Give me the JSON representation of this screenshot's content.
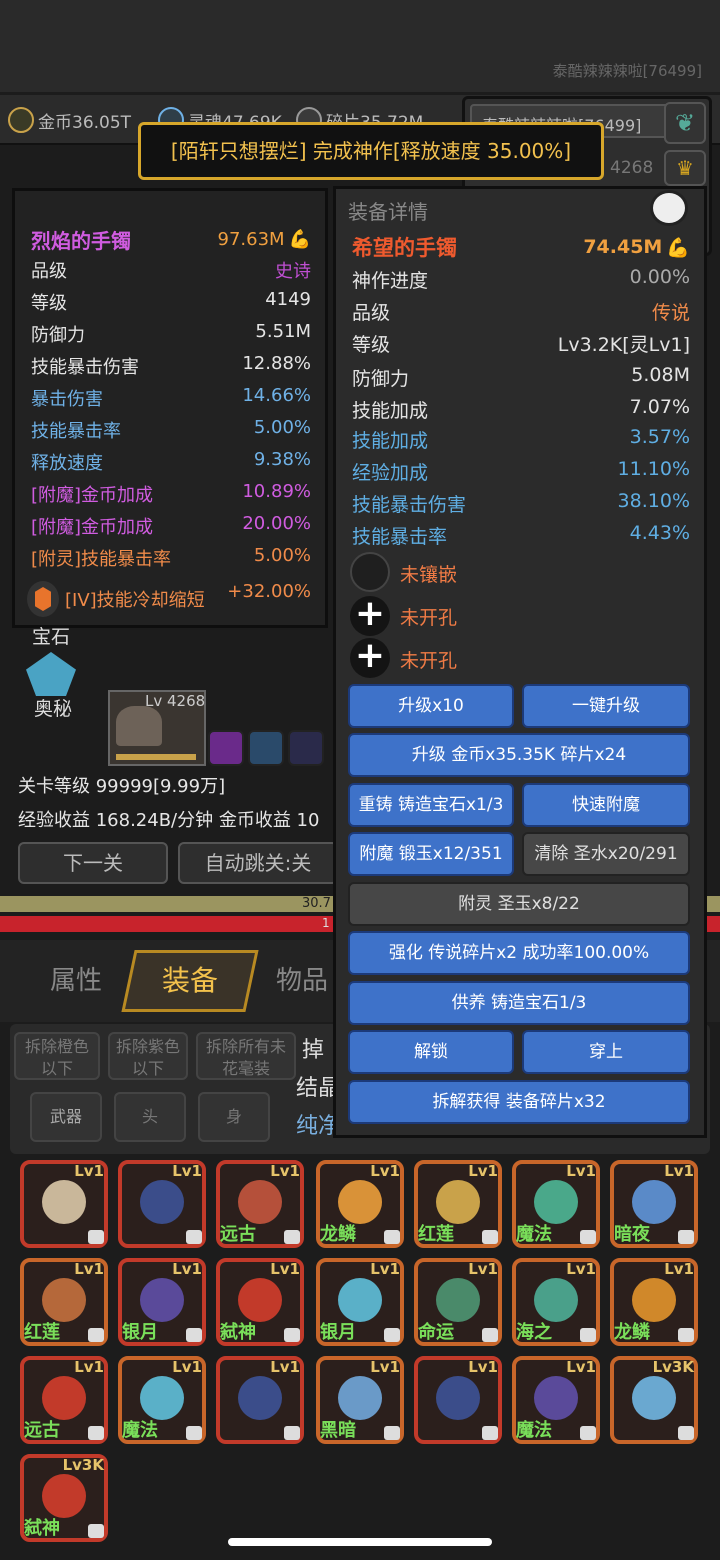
{
  "top": {
    "player_name": "泰酷辣辣辣啦[76499]"
  },
  "resources": [
    {
      "label": "金币36.05T",
      "icon": "coin-icon"
    },
    {
      "label": "灵魂47.69K",
      "icon": "soul-icon"
    },
    {
      "label": "碎片35.72M",
      "icon": "shard-icon"
    }
  ],
  "right_panel": {
    "name": "泰酷辣辣辣啦[76499]",
    "level": "4268"
  },
  "toast": "[陌轩只想摆烂] 完成神作[释放速度 35.00%]",
  "left_item": {
    "name": "烈焰的手镯",
    "power": "97.63M",
    "rows": [
      {
        "label": "品级",
        "value": "史诗"
      },
      {
        "label": "等级",
        "value": "4149"
      },
      {
        "label": "防御力",
        "value": "5.51M"
      },
      {
        "label": "技能暴击伤害",
        "value": "12.88%"
      },
      {
        "label": "暴击伤害",
        "value": "14.66%"
      },
      {
        "label": "技能暴击率",
        "value": "5.00%"
      },
      {
        "label": "释放速度",
        "value": "9.38%"
      },
      {
        "label": "[附魔]金币加成",
        "value": "10.89%"
      },
      {
        "label": "[附魔]金币加成",
        "value": "20.00%"
      },
      {
        "label": "[附灵]技能暴击率",
        "value": "5.00%"
      }
    ],
    "gem": {
      "label": "[IV]技能冷却缩短",
      "value": "+32.00%"
    }
  },
  "left_side": {
    "gem_label": "宝石",
    "mystic_label": "奥秘",
    "pet_level": "Lv 4268"
  },
  "stage": {
    "level": "关卡等级 99999[9.99万]",
    "income": "经验收益 168.24B/分钟 金币收益 10"
  },
  "buttons": {
    "next": "下一关",
    "auto": "自动跳关:关"
  },
  "bars": {
    "exp": "30.7",
    "hp": "1"
  },
  "tabs": {
    "attributes": "属性",
    "equipment": "装备",
    "items": "物品"
  },
  "filters": {
    "remove_orange": "拆除橙色\n以下",
    "remove_purple": "拆除紫色\n以下",
    "remove_all": "拆除所有未\n花毫装",
    "drop": "掉",
    "crystal": "结晶",
    "pure": "纯净",
    "slots": [
      "武器",
      "头",
      "身"
    ]
  },
  "detail": {
    "title": "装备详情",
    "name": "希望的手镯",
    "power": "74.45M",
    "rows": [
      {
        "label": "神作进度",
        "value": "0.00%"
      },
      {
        "label": "品级",
        "value": "传说"
      },
      {
        "label": "等级",
        "value": "Lv3.2K[灵Lv1]"
      },
      {
        "label": "防御力",
        "value": "5.08M"
      },
      {
        "label": "技能加成",
        "value": "7.07%"
      },
      {
        "label": "技能加成",
        "value": "3.57%"
      },
      {
        "label": "经验加成",
        "value": "11.10%"
      },
      {
        "label": "技能暴击伤害",
        "value": "38.10%"
      },
      {
        "label": "技能暴击率",
        "value": "4.43%"
      }
    ],
    "slots": [
      "未镶嵌",
      "未开孔",
      "未开孔"
    ],
    "actions": {
      "upgrade10": "升级x10",
      "upgrade_all": "一键升级",
      "upgrade_cost": "升级 金币x35.35K 碎片x24",
      "recast": "重铸 铸造宝石x1/3",
      "quick_enchant": "快速附魔",
      "enchant": "附魔 锻玉x12/351",
      "clear": "清除 圣水x20/291",
      "spirit": "附灵 圣玉x8/22",
      "strengthen": "强化 传说碎片x2 成功率100.00%",
      "nurture": "供养 铸造宝石1/3",
      "unlock": "解锁",
      "equip": "穿上",
      "dismantle": "拆解获得 装备碎片x32"
    }
  },
  "inventory": [
    {
      "lv": "Lv1",
      "name": "",
      "art": "#c9b79a",
      "frame": "#c23a2a"
    },
    {
      "lv": "Lv1",
      "name": "",
      "art": "#3b4d8a",
      "frame": "#c23a2a"
    },
    {
      "lv": "Lv1",
      "name": "远古",
      "art": "#b5503a",
      "frame": "#c23a2a"
    },
    {
      "lv": "Lv1",
      "name": "龙鳞",
      "art": "#d99238",
      "frame": "#c8662a"
    },
    {
      "lv": "Lv1",
      "name": "红莲",
      "art": "#c9a24a",
      "frame": "#c8662a"
    },
    {
      "lv": "Lv1",
      "name": "魔法",
      "art": "#4aa88a",
      "frame": "#c8662a"
    },
    {
      "lv": "Lv1",
      "name": "暗夜",
      "art": "#5a8ac8",
      "frame": "#c8662a"
    },
    {
      "lv": "Lv1",
      "name": "红莲",
      "art": "#b5683a",
      "frame": "#c8662a"
    },
    {
      "lv": "Lv1",
      "name": "银月",
      "art": "#5a4a9a",
      "frame": "#c23a2a"
    },
    {
      "lv": "Lv1",
      "name": "弑神",
      "art": "#c23a2a",
      "frame": "#c23a2a"
    },
    {
      "lv": "Lv1",
      "name": "银月",
      "art": "#5ab0c8",
      "frame": "#c8662a"
    },
    {
      "lv": "Lv1",
      "name": "命运",
      "art": "#4a8a6a",
      "frame": "#c8662a"
    },
    {
      "lv": "Lv1",
      "name": "海之",
      "art": "#4aa08a",
      "frame": "#c8662a"
    },
    {
      "lv": "Lv1",
      "name": "龙鳞",
      "art": "#d0882a",
      "frame": "#c8662a"
    },
    {
      "lv": "Lv1",
      "name": "远古",
      "art": "#c23a2a",
      "frame": "#c23a2a"
    },
    {
      "lv": "Lv1",
      "name": "魔法",
      "art": "#5ab0c8",
      "frame": "#c8662a"
    },
    {
      "lv": "Lv1",
      "name": "",
      "art": "#3b4d8a",
      "frame": "#c23a2a"
    },
    {
      "lv": "Lv1",
      "name": "黑暗",
      "art": "#6a9ac8",
      "frame": "#c8662a"
    },
    {
      "lv": "Lv1",
      "name": "",
      "art": "#3b4d8a",
      "frame": "#c23a2a"
    },
    {
      "lv": "Lv1",
      "name": "魔法",
      "art": "#5a4a9a",
      "frame": "#c8662a"
    },
    {
      "lv": "Lv3K",
      "name": "",
      "art": "#6aa8d0",
      "frame": "#c8662a"
    },
    {
      "lv": "Lv3K",
      "name": "弑神",
      "art": "#c23a2a",
      "frame": "#c23a2a"
    }
  ],
  "colors": {
    "gold": "#f2c14e",
    "blue_button": "#3e72c9",
    "legend_orange": "#f07b45",
    "epic_purple": "#c04fd3"
  }
}
